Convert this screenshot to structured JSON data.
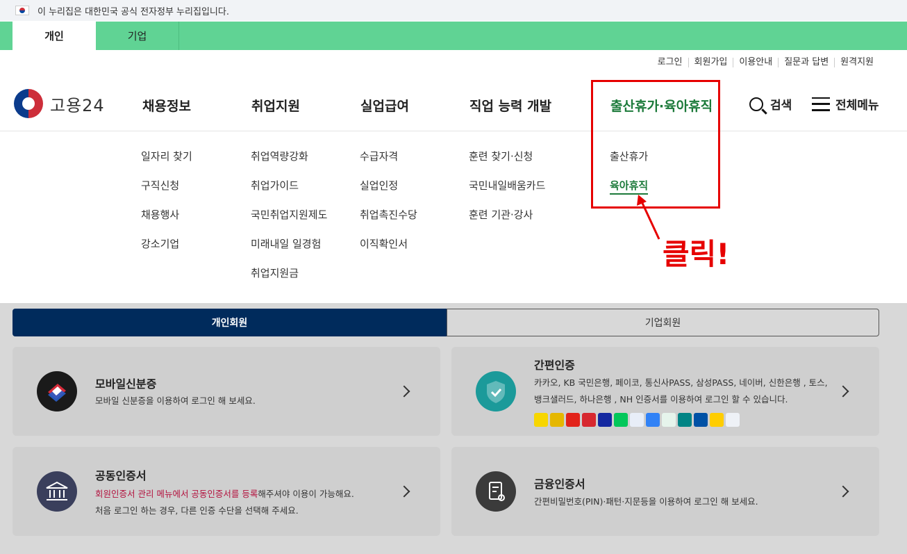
{
  "gov_banner": {
    "text": "이 누리집은 대한민국 공식 전자정부 누리집입니다."
  },
  "tabs": [
    {
      "label": "개인"
    },
    {
      "label": "기업"
    }
  ],
  "util_links": [
    "로그인",
    "회원가입",
    "이용안내",
    "질문과 답변",
    "원격지원"
  ],
  "logo": {
    "text": "고용24"
  },
  "gnb": [
    "채용정보",
    "취업지원",
    "실업급여",
    "직업 능력 개발",
    "출산휴가·육아휴직"
  ],
  "header_actions": {
    "search": "검색",
    "all_menu": "전체메뉴"
  },
  "submenus": [
    [
      "일자리 찾기",
      "구직신청",
      "채용행사",
      "강소기업"
    ],
    [
      "취업역량강화",
      "취업가이드",
      "국민취업지원제도",
      "미래내일 일경험",
      "취업지원금"
    ],
    [
      "수급자격",
      "실업인정",
      "취업촉진수당",
      "이직확인서"
    ],
    [
      "훈련 찾기·신청",
      "국민내일배움카드",
      "훈련 기관·강사"
    ],
    [
      "출산휴가",
      "육아휴직"
    ]
  ],
  "annotation": {
    "label": "클릭!"
  },
  "member_tabs": {
    "personal": "개인회원",
    "corporate": "기업회원"
  },
  "cards": {
    "mobile_id": {
      "title": "모바일신분증",
      "desc": "모바일 신분증을 이용하여 로그인 해 보세요."
    },
    "simple_auth": {
      "title": "간편인증",
      "desc1": "카카오, KB 국민은행, 페이코, 통신사PASS, 삼성PASS, 네이버, 신한은행 , 토스,",
      "desc2": "뱅크샐러드, 하나은행 , NH 인증서를 이용하여 로그인 할 수 있습니다."
    },
    "joint_cert": {
      "title": "공동인증서",
      "desc_em": "회원인증서 관리 메뉴에서 공동인증서를 등록",
      "desc_rest": "해주셔야 이용이 가능해요.",
      "desc2": "처음 로그인 하는 경우, 다른 인증 수단을 선택해 주세요."
    },
    "finance_cert": {
      "title": "금융인증서",
      "desc": "간편비밀번호(PIN)·패턴·지문등을 이용하여 로그인 해 보세요."
    }
  },
  "colors": {
    "green_bar": "#60d394",
    "active_menu": "#1c7a3a",
    "annotation_red": "#e60000",
    "navy": "#002b5c"
  }
}
